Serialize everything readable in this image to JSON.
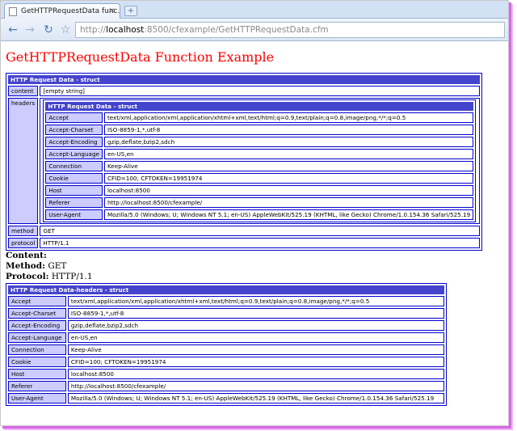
{
  "browser": {
    "tab_title": "GetHTTPRequestData func...",
    "tab_close": "×",
    "new_tab": "+",
    "url_prefix": "http://",
    "url_host": "localhost",
    "url_rest": ":8500/cfexample/GetHTTPRequestData.cfm"
  },
  "page": {
    "title": "GetHTTPRequestData Function Example",
    "dump1": {
      "header": "HTTP Request Data - struct",
      "content_key": "content",
      "content_val": "[empty string]",
      "headers_key": "headers",
      "headers_header": "HTTP Request Data - struct",
      "method_key": "method",
      "method_val": "GET",
      "protocol_key": "protocol",
      "protocol_val": "HTTP/1.1"
    },
    "headers": [
      {
        "key": "Accept",
        "val": "text/xml,application/xml,application/xhtml+xml,text/html;q=0.9,text/plain;q=0.8,image/png,*/*;q=0.5"
      },
      {
        "key": "Accept-Charset",
        "val": "ISO-8859-1,*,utf-8"
      },
      {
        "key": "Accept-Encoding",
        "val": "gzip,deflate,bzip2,sdch"
      },
      {
        "key": "Accept-Language",
        "val": "en-US,en"
      },
      {
        "key": "Connection",
        "val": "Keep-Alive"
      },
      {
        "key": "Cookie",
        "val": "CFID=100; CFTOKEN=19951974"
      },
      {
        "key": "Host",
        "val": "localhost:8500"
      },
      {
        "key": "Referer",
        "val": "http://localhost:8500/cfexample/"
      },
      {
        "key": "User-Agent",
        "val": "Mozilla/5.0 (Windows; U; Windows NT 5.1; en-US) AppleWebKit/525.19 (KHTML, like Gecko) Chrome/1.0.154.36 Safari/525.19"
      }
    ],
    "content_label": "Content:",
    "method_label": "Method:",
    "method_value": "GET",
    "protocol_label": "Protocol:",
    "protocol_value": "HTTP/1.1",
    "dump2_header": "HTTP Request Data-headers - struct"
  }
}
